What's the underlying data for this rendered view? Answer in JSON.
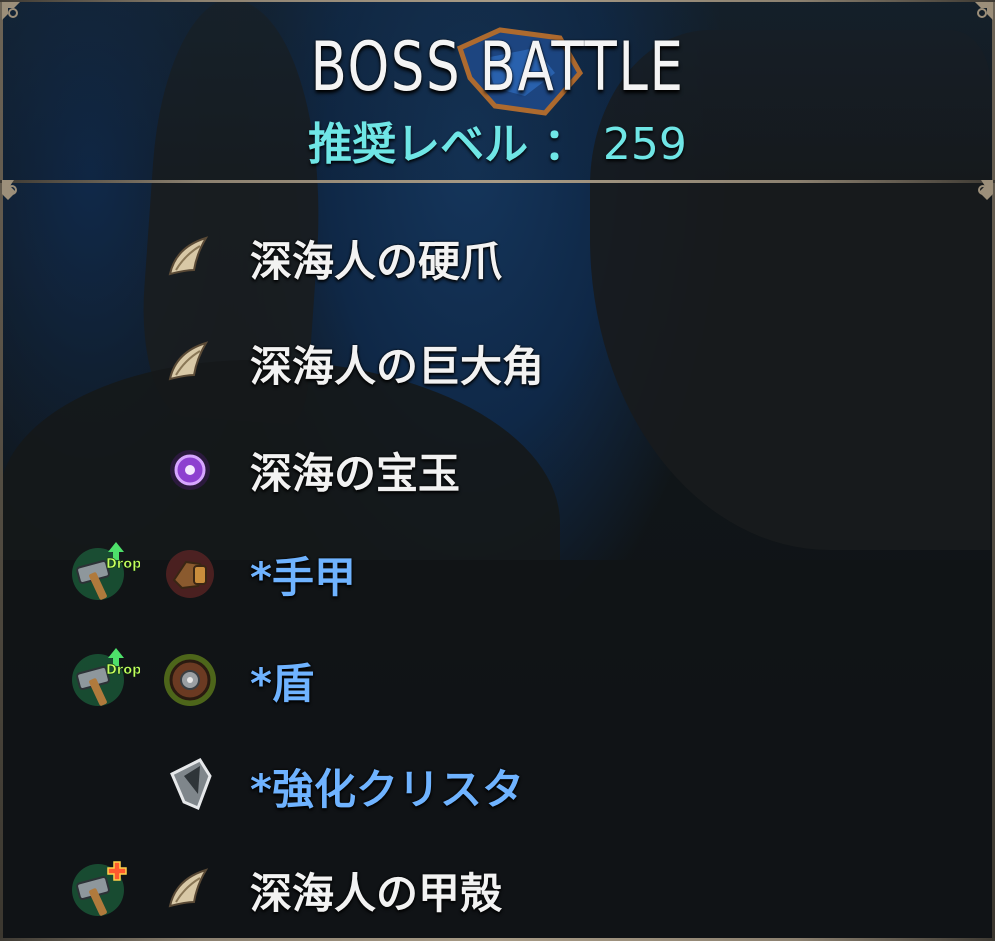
{
  "header": {
    "title": "BOSS BATTLE",
    "level_label": "推奨レベル ：",
    "level_value": "259"
  },
  "colors": {
    "title": "#f4f4f4",
    "level": "#6fe6e6",
    "item_white": "#f2f2f2",
    "item_blue": "#6fb3ff",
    "frame": "#a89b86"
  },
  "items": [
    {
      "label": "深海人の硬爪",
      "icon": "claw-icon",
      "badge": null
    },
    {
      "label": "深海人の巨大角",
      "icon": "claw-icon",
      "badge": null
    },
    {
      "label": "深海の宝玉",
      "icon": "purple-orb-icon",
      "badge": null
    },
    {
      "label": "*手甲",
      "icon": "gauntlet-icon",
      "badge": "drop-up-hammer-icon",
      "badge_text": "Drop"
    },
    {
      "label": "*盾",
      "icon": "shield-icon",
      "badge": "drop-up-hammer-icon",
      "badge_text": "Drop"
    },
    {
      "label": "*強化クリスタ",
      "icon": "crystal-icon",
      "badge": null
    },
    {
      "label": "深海人の甲殻",
      "icon": "claw-icon",
      "badge": "plus-hammer-icon"
    }
  ]
}
